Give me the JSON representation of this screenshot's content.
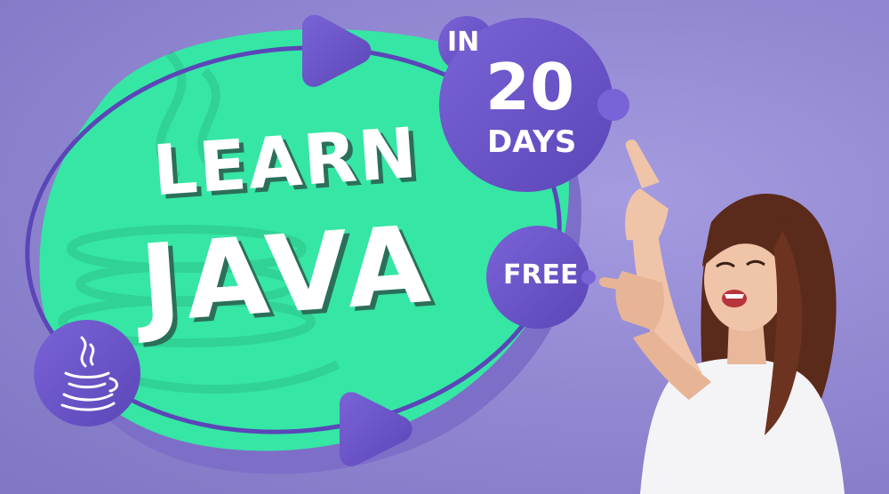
{
  "title": {
    "line1": "LEARN",
    "line2": "JAVA"
  },
  "badge": {
    "in": "IN",
    "number": "20",
    "unit": "DAYS"
  },
  "free_label": "FREE",
  "colors": {
    "background": "#8f85d0",
    "blob": "#36e6a4",
    "purple": "#6a54c4",
    "white": "#ffffff"
  },
  "icons": [
    "java-coffee-cup-icon",
    "play-triangle-icon"
  ]
}
